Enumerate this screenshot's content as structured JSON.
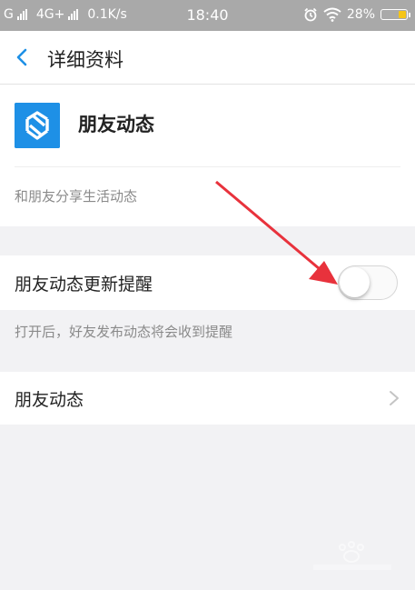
{
  "status_bar": {
    "carrier1": "G",
    "carrier2": "4G+",
    "speed": "0.1K/s",
    "time": "18:40",
    "battery": "28%",
    "battery_level": 0.28
  },
  "nav": {
    "title": "详细资料"
  },
  "app": {
    "name": "朋友动态",
    "description": "和朋友分享生活动态"
  },
  "notify_row": {
    "label": "朋友动态更新提醒",
    "toggle_on": false,
    "hint": "打开后，好友发布动态将会收到提醒"
  },
  "link_row": {
    "label": "朋友动态"
  },
  "colors": {
    "accent": "#1e90e6",
    "status_bar": "#a9a9a9",
    "arrow": "#e8323c",
    "battery": "#f5c518"
  }
}
